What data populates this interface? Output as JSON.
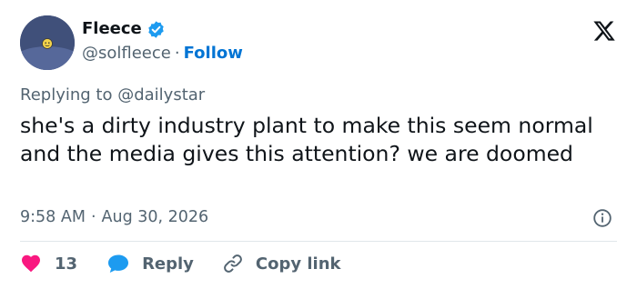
{
  "author": {
    "display_name": "Fleece",
    "handle": "@solfleece",
    "follow_label": "Follow",
    "separator": "·",
    "verified": true,
    "verified_color": "#1d9bf0"
  },
  "reply_context": {
    "prefix": "Replying to",
    "username": "@dailystar"
  },
  "tweet": {
    "text": "she's a dirty industry plant to make this seem normal and the media gives this attention? we are doomed",
    "time": "9:58 AM",
    "separator": "·",
    "date": "Aug 30, 2026"
  },
  "actions": {
    "like_count": "13",
    "reply_label": "Reply",
    "copy_link_label": "Copy link"
  },
  "colors": {
    "heart": "#f91880",
    "reply_bubble": "#1d9bf0",
    "follow_link": "#0074d4",
    "secondary_text": "#536471"
  },
  "icons": [
    "verified-badge-icon",
    "x-logo-icon",
    "info-icon",
    "heart-icon",
    "reply-bubble-icon",
    "link-icon"
  ]
}
